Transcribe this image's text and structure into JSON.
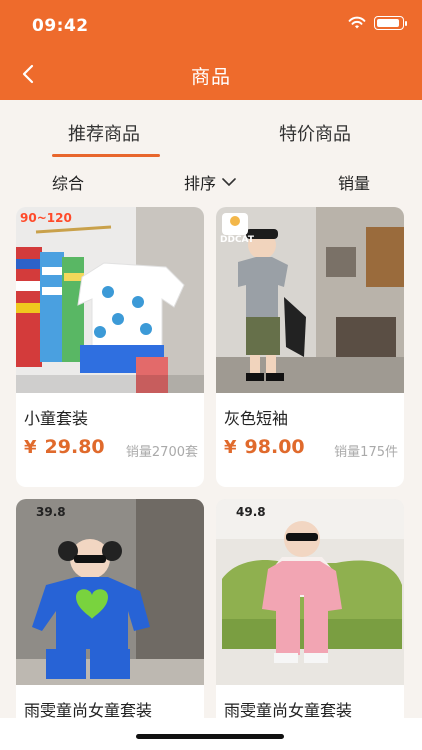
{
  "status_bar": {
    "time": "09:42"
  },
  "nav": {
    "title": "商品"
  },
  "tabs": [
    {
      "label": "推荐商品",
      "active": true
    },
    {
      "label": "特价商品",
      "active": false
    }
  ],
  "sort": [
    {
      "label": "综合"
    },
    {
      "label": "排序"
    },
    {
      "label": "销量"
    }
  ],
  "products": [
    {
      "name": "小童套装",
      "currency": "¥",
      "price": "29.80",
      "sales": "销量2700套",
      "badge": "90~120"
    },
    {
      "name": "灰色短袖",
      "currency": "¥",
      "price": "98.00",
      "sales": "销量175件",
      "badge": "DDCAT"
    },
    {
      "name": "雨雯童尚女童套装",
      "badge": "39.8"
    },
    {
      "name": "雨雯童尚女童套装",
      "badge": "49.8"
    }
  ],
  "colors": {
    "brand": "#ee6b2c",
    "price": "#e06a2c",
    "background": "#f7f3ef"
  }
}
